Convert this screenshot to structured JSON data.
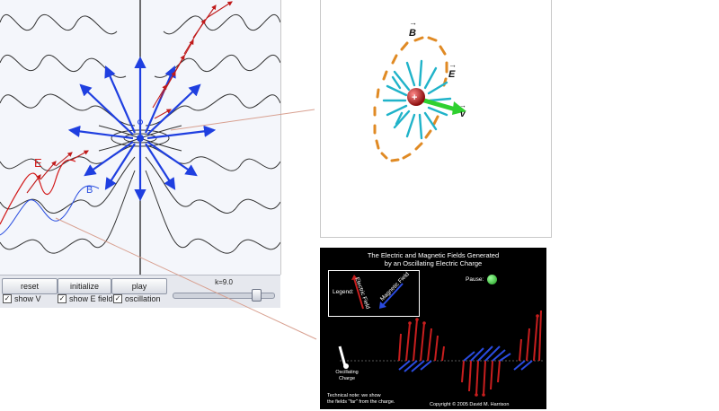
{
  "left_panel": {
    "field_labels": {
      "e": "E",
      "b": "B"
    },
    "buttons": {
      "reset": "reset",
      "initialize": "initialize",
      "play": "play"
    },
    "checkboxes": [
      {
        "label": "show V",
        "checked": true
      },
      {
        "label": "show E field",
        "checked": true
      },
      {
        "label": "oscillation",
        "checked": true
      }
    ],
    "slider": {
      "label": "k=9.0",
      "value_fraction": 0.85
    }
  },
  "right_panel": {
    "labels": {
      "b": "B",
      "e": "E",
      "v": "v"
    },
    "colors": {
      "b_arrows": "#e08a24",
      "e_arrows": "#20b3c9",
      "charge": "#c8191b",
      "velocity": "#2fd02f"
    }
  },
  "dark_panel": {
    "title_line1": "The Electric and Magnetic Fields Generated",
    "title_line2": "by an Oscillating Electric Charge",
    "legend": {
      "label": "Legend:",
      "electric": "Electric Field",
      "magnetic": "Magnetic Field"
    },
    "pause_label": "Pause:",
    "charge_label_line1": "Oscillating",
    "charge_label_line2": "Charge",
    "note_line1": "Technical note: we show",
    "note_line2": "the fields \"far\" from the charge.",
    "copyright": "Copyright © 2005 David M. Harrison",
    "colors": {
      "electric": "#c81e1e",
      "magnetic": "#2a4be0"
    }
  }
}
